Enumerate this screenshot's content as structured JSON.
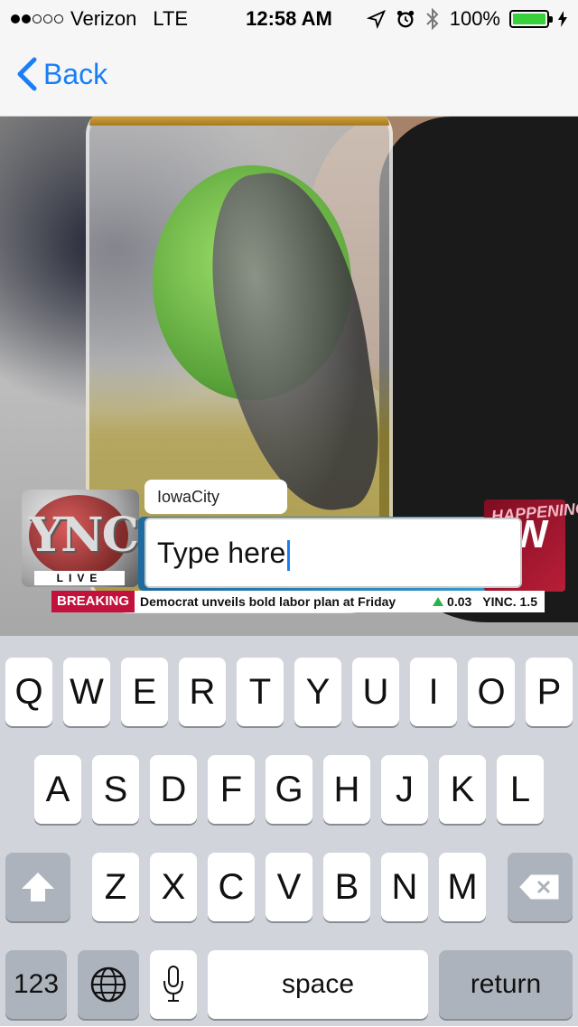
{
  "status_bar": {
    "carrier": "Verizon",
    "network": "LTE",
    "time": "12:58 AM",
    "battery_percent": "100%",
    "battery_level": 1.0,
    "signal_bars_filled": 2,
    "signal_bars_total": 5
  },
  "nav": {
    "back_label": "Back",
    "accent_color": "#1a7ff5"
  },
  "overlay": {
    "logo_text": "YNC",
    "logo_sub": "LIVE",
    "location": "IowaCity",
    "input_placeholder": "Type here",
    "happening_text": "HAPPENING",
    "happening_big": "W",
    "breaking": "BREAKING",
    "headline": "Democrat unveils bold labor plan at Friday",
    "stock_change": "0.03",
    "stock_ticker": "YINC. 1.5",
    "breaking_color": "#c2123c"
  },
  "keyboard": {
    "row1": [
      "Q",
      "W",
      "E",
      "R",
      "T",
      "Y",
      "U",
      "I",
      "O",
      "P"
    ],
    "row2": [
      "A",
      "S",
      "D",
      "F",
      "G",
      "H",
      "J",
      "K",
      "L"
    ],
    "row3": [
      "Z",
      "X",
      "C",
      "V",
      "B",
      "N",
      "M"
    ],
    "numbers_key": "123",
    "space_key": "space",
    "return_key": "return"
  }
}
